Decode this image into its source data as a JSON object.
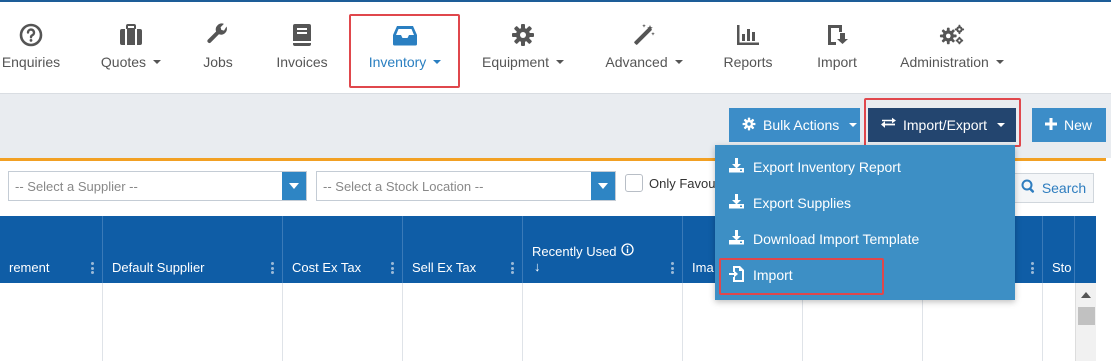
{
  "nav": {
    "items": [
      {
        "label": "Enquiries",
        "icon": "question-circle-icon",
        "caret": false
      },
      {
        "label": "Quotes",
        "icon": "briefcase-icon",
        "caret": true
      },
      {
        "label": "Jobs",
        "icon": "wrench-icon",
        "caret": false
      },
      {
        "label": "Invoices",
        "icon": "book-icon",
        "caret": false
      },
      {
        "label": "Inventory",
        "icon": "inbox-tray-icon",
        "caret": true,
        "active": true
      },
      {
        "label": "Equipment",
        "icon": "gear-icon",
        "caret": true
      },
      {
        "label": "Advanced",
        "icon": "magic-wand-icon",
        "caret": true
      },
      {
        "label": "Reports",
        "icon": "bar-chart-icon",
        "caret": false
      },
      {
        "label": "Import",
        "icon": "import-arrow-icon",
        "caret": false
      },
      {
        "label": "Administration",
        "icon": "gears-icon",
        "caret": true
      }
    ]
  },
  "toolbar": {
    "bulk_label": "Bulk Actions",
    "import_export_label": "Import/Export",
    "new_label": "New"
  },
  "filters": {
    "supplier_placeholder": "-- Select a Supplier --",
    "location_placeholder": "-- Select a Stock Location --",
    "favourites_label": "Only Favourites",
    "search_label": "Search"
  },
  "grid": {
    "columns": [
      "rement",
      "Default Supplier",
      "Cost Ex Tax",
      "Sell Ex Tax",
      "Recently Used",
      "Ima",
      "",
      "",
      "Sto"
    ],
    "sort_indicator": "↓"
  },
  "dropdown": {
    "items": [
      {
        "label": "Export Inventory Report",
        "icon": "download-icon"
      },
      {
        "label": "Export Supplies",
        "icon": "download-icon"
      },
      {
        "label": "Download Import Template",
        "icon": "download-icon"
      },
      {
        "label": "Import",
        "icon": "import-file-icon"
      }
    ]
  },
  "colors": {
    "accent": "#2a7fc1",
    "nav_border": "#1d5d98",
    "grid_header": "#0f5da6",
    "dropdown_bg": "#3d8fc5",
    "highlight": "#e0474c",
    "orange_rule": "#f2a023"
  }
}
